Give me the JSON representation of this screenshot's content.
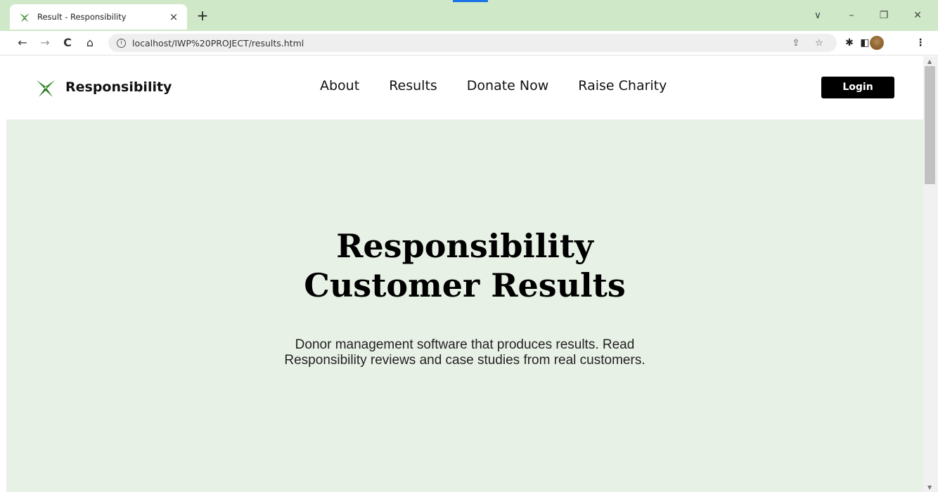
{
  "browser": {
    "tab_title": "Result - Responsibility",
    "tab_close": "×",
    "new_tab": "+",
    "url": "localhost/IWP%20PROJECT/results.html",
    "window_controls": {
      "tab_search": "∨",
      "minimize": "–",
      "restore": "❐",
      "close": "✕"
    },
    "nav_icons": {
      "back": "←",
      "forward": "→",
      "reload": "C",
      "home": "⌂"
    },
    "toolbar_icons": {
      "share": "⇪",
      "bookmark": "☆",
      "extensions": "✱",
      "side_panel": "◧",
      "menu": "⋮"
    }
  },
  "site": {
    "logo_text": "Responsibility",
    "nav": [
      "About",
      "Results",
      "Donate Now",
      "Raise Charity"
    ],
    "login_label": "Login",
    "hero": {
      "title_line1": "Responsibility",
      "title_line2": "Customer Results",
      "subtitle_line1": "Donor management software that produces results. Read",
      "subtitle_line2": "Responsibility reviews and case studies from real customers."
    }
  },
  "colors": {
    "tabstrip": "#cfe9c8",
    "hero_bg": "#e8f1e6",
    "logo_green": "#3a8f2e",
    "login_bg": "#000000"
  }
}
